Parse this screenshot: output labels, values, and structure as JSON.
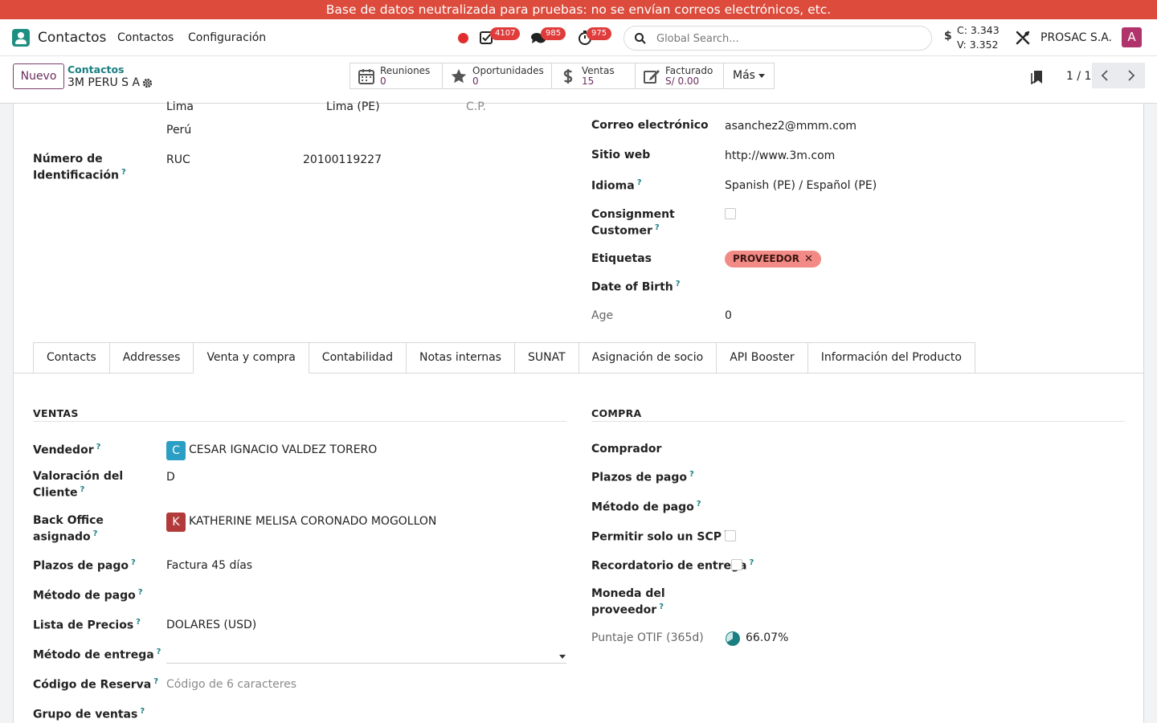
{
  "banner": {
    "text": "Base de datos neutralizada para pruebas: no se envían correos electrónicos, etc."
  },
  "navbar": {
    "app_name": "Contactos",
    "menu": [
      "Contactos",
      "Configuración"
    ],
    "activities_count": "4107",
    "messages_count": "985",
    "timer_count": "975",
    "search_placeholder": "Global Search...",
    "currency_symbol": "$",
    "rate_c": "C: 3.343",
    "rate_v": "V: 3.352",
    "company": "PROSAC S.A.",
    "avatar_letter": "A"
  },
  "control": {
    "new_label": "Nuevo",
    "breadcrumb_parent": "Contactos",
    "breadcrumb_current": "3M PERU S A",
    "smart_buttons": [
      {
        "label": "Reuniones",
        "value": "0",
        "icon": "calendar-icon"
      },
      {
        "label": "Oportunidades",
        "value": "0",
        "icon": "star-icon"
      },
      {
        "label": "Ventas",
        "value": "15",
        "icon": "dollar-icon"
      },
      {
        "label": "Facturado",
        "value": "S/ 0.00",
        "icon": "edit-icon"
      }
    ],
    "more_label": "Más",
    "pager": "1 / 1"
  },
  "address": {
    "city": "Lima",
    "state": "Lima (PE)",
    "zip_placeholder": "C.P.",
    "country": "Perú"
  },
  "identification": {
    "label": "Número de Identificación",
    "type": "RUC",
    "number": "20100119227"
  },
  "contact_info": {
    "email_label": "Correo electrónico",
    "email": "asanchez2@mmm.com",
    "website_label": "Sitio web",
    "website": "http://www.3m.com",
    "language_label": "Idioma",
    "language": "Spanish (PE) / Español (PE)",
    "consignment_label_1": "Consignment",
    "consignment_label_2": "Customer",
    "tags_label": "Etiquetas",
    "tag": "PROVEEDOR",
    "dob_label": "Date of Birth",
    "age_label": "Age",
    "age": "0"
  },
  "tabs": [
    "Contacts",
    "Addresses",
    "Venta y compra",
    "Contabilidad",
    "Notas internas",
    "SUNAT",
    "Asignación de socio",
    "API Booster",
    "Información del Producto"
  ],
  "ventas": {
    "title": "VENTAS",
    "vendedor_label": "Vendedor",
    "vendedor_initial": "C",
    "vendedor": "CESAR IGNACIO VALDEZ TORERO",
    "valoracion_label_1": "Valoración del",
    "valoracion_label_2": "Cliente",
    "valoracion": "D",
    "backoffice_label_1": "Back Office",
    "backoffice_label_2": "asignado",
    "backoffice_initial": "K",
    "backoffice": "KATHERINE MELISA CORONADO MOGOLLON",
    "plazos_label": "Plazos de pago",
    "plazos": "Factura 45 días",
    "metodo_pago_label": "Método de pago",
    "lista_precios_label": "Lista de Precios",
    "lista_precios": "DOLARES (USD)",
    "metodo_entrega_label": "Método de entrega",
    "codigo_reserva_label": "Código de Reserva",
    "codigo_reserva_placeholder": "Código de 6 caracteres",
    "grupo_ventas_label": "Grupo de ventas"
  },
  "compra": {
    "title": "COMPRA",
    "comprador_label": "Comprador",
    "plazos_label": "Plazos de pago",
    "metodo_pago_label": "Método de pago",
    "scp_label": "Permitir solo un SCP",
    "recordatorio_label": "Recordatorio de entrega",
    "moneda_label_1": "Moneda del",
    "moneda_label_2": "proveedor",
    "otif_label": "Puntaje OTIF (365d)",
    "otif": "66.07%"
  },
  "colors": {
    "banner": "#dc4b3c",
    "primary": "#6b2d5e",
    "accent": "#1b7f82",
    "tag": "#f28b86"
  }
}
